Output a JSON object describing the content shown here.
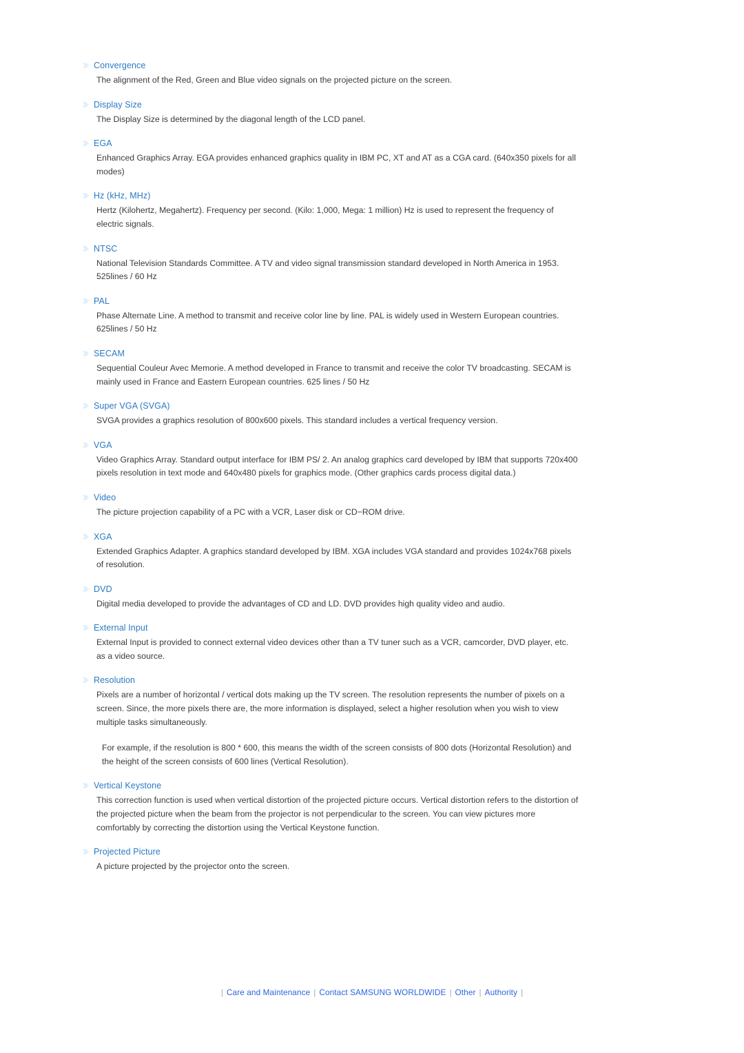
{
  "colors": {
    "heading": "#2a7ac4",
    "body": "#3a3a3a",
    "footer_link": "#2a64e0",
    "bullet": "#aed4ec",
    "background": "#ffffff"
  },
  "glossary": {
    "bullet_icon": "double-chevron-icon",
    "entries": [
      {
        "term": "Convergence",
        "definition": "The alignment of the Red, Green and Blue video signals on the projected picture on the screen."
      },
      {
        "term": "Display Size",
        "definition": "The Display Size is determined by the diagonal length of the LCD panel."
      },
      {
        "term": "EGA",
        "definition": "Enhanced Graphics Array. EGA provides enhanced graphics quality in IBM PC, XT and AT as a CGA card. (640x350 pixels for all modes)"
      },
      {
        "term": "Hz (kHz, MHz)",
        "definition": "Hertz (Kilohertz, Megahertz). Frequency per second. (Kilo: 1,000, Mega: 1 million) Hz is used to represent the frequency of electric signals."
      },
      {
        "term": "NTSC",
        "definition": "National Television Standards Committee. A TV and video signal transmission standard developed in North America in 1953. 525lines / 60 Hz"
      },
      {
        "term": "PAL",
        "definition": "Phase Alternate Line. A method to transmit and receive color line by line. PAL is widely used in Western European countries. 625lines / 50 Hz"
      },
      {
        "term": "SECAM",
        "definition": "Sequential Couleur Avec Memorie. A method developed in France to transmit and receive the color TV broadcasting. SECAM is mainly used in France and Eastern European countries. 625 lines / 50 Hz"
      },
      {
        "term": "Super VGA (SVGA)",
        "definition": "SVGA provides a graphics resolution of 800x600 pixels. This standard includes a vertical frequency version."
      },
      {
        "term": "VGA",
        "definition": "Video Graphics Array. Standard output interface for IBM PS/ 2. An analog graphics card developed by IBM that supports 720x400 pixels resolution in text mode and 640x480 pixels for graphics mode. (Other graphics cards process digital data.)"
      },
      {
        "term": "Video",
        "definition": "The picture projection capability of a PC with a VCR, Laser disk or CD−ROM drive."
      },
      {
        "term": "XGA",
        "definition": "Extended Graphics Adapter. A graphics standard developed by IBM. XGA includes VGA standard and provides 1024x768 pixels of resolution."
      },
      {
        "term": "DVD",
        "definition": "Digital media developed to provide the advantages of CD and LD. DVD provides high quality video and audio."
      },
      {
        "term": "External Input",
        "definition": "External Input is provided to connect external video devices other than a TV tuner such as a VCR, camcorder, DVD player, etc. as a video source."
      },
      {
        "term": "Resolution",
        "definition": "Pixels are a number of horizontal / vertical dots making up the TV screen. The resolution represents the number of pixels on a screen. Since, the more pixels there are, the more information is displayed, select a higher resolution when you wish to view multiple tasks simultaneously.",
        "note": "For example, if the resolution is 800 * 600, this means the width of the screen consists of 800 dots (Horizontal Resolution) and the height of the screen consists of 600 lines (Vertical Resolution)."
      },
      {
        "term": "Vertical Keystone",
        "definition": "This correction function is used when vertical distortion of the projected picture occurs. Vertical distortion refers to the distortion of the projected picture when the beam from the projector is not perpendicular to the screen. You can view pictures more comfortably by correcting the distortion using the Vertical Keystone function."
      },
      {
        "term": "Projected Picture",
        "definition": "A picture projected by the projector onto the screen."
      }
    ]
  },
  "footer": {
    "separator": "|",
    "links": [
      "Care and Maintenance",
      "Contact SAMSUNG WORLDWIDE",
      "Other",
      "Authority"
    ]
  }
}
